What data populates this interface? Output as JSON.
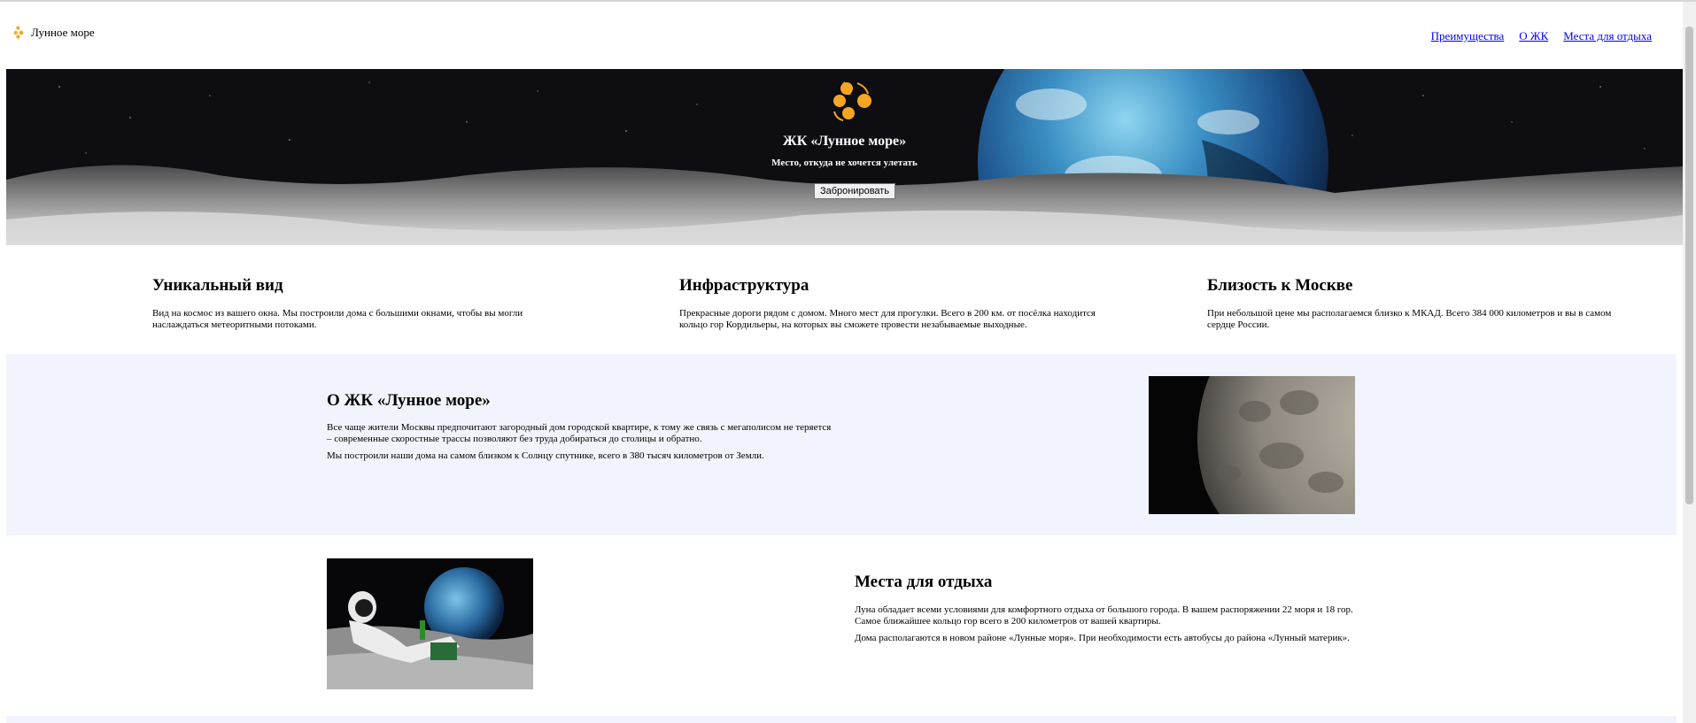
{
  "header": {
    "logo_text": "Лунное море",
    "nav": [
      {
        "label": "Преимущества"
      },
      {
        "label": "О ЖК"
      },
      {
        "label": "Места для отдыха"
      }
    ]
  },
  "hero": {
    "title": "ЖК «Лунное море»",
    "subtitle": "Место, откуда не хочется улетать",
    "button_label": "Забронировать"
  },
  "features": [
    {
      "title": "Уникальный вид",
      "text": "Вид на космос из вашего окна. Мы построили дома с большими окнами, чтобы вы могли наслаждаться метеоритными потоками."
    },
    {
      "title": "Инфраструктура",
      "text": "Прекрасные дороги рядом с домом. Много мест для прогулки. Всего в 200 км. от посёлка находится кольцо гор Кордильеры, на которых вы сможете провести незабываемые выходные."
    },
    {
      "title": "Близость к Москве",
      "text": "При небольшой цене мы располагаемся близко к МКАД. Всего 384 000 километров и вы в самом сердце России."
    }
  ],
  "about": {
    "title": "О ЖК «Лунное море»",
    "paragraphs": [
      "Все чаще жители Москвы предпочитают загородный дом городской квартире, к тому же связь с мегаполисом не теряется – современные скоростные трассы позволяют без труда добираться до столицы и обратно.",
      "Мы построили наши дома на самом близком к Солнцу спутнике, всего в 380 тысяч километров от Земли."
    ]
  },
  "places": {
    "title": "Места для отдыха",
    "paragraphs": [
      "Луна обладает всеми условиями для комфортного отдыха от большого города. В вашем распоряжении 22 моря и 18 гор. Самое ближайшее кольцо гор всего в 200 километров от вашей квартиры.",
      "Дома располагаются в новом районе «Лунные моря». При необходимости есть автобусы до района «Лунный материк»."
    ]
  },
  "colors": {
    "brand": "#f5a623",
    "link": "#0000ee",
    "section_bg": "#f2f4fd"
  }
}
